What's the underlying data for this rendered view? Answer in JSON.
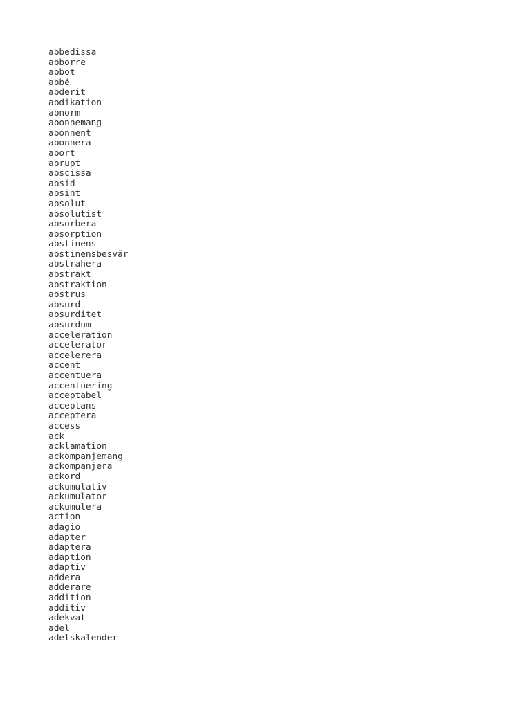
{
  "page": {
    "kind": "plain-text-word-list",
    "background_color": "#ffffff",
    "text_color": "#333333"
  },
  "word_list": {
    "items": [
      "abbedissa",
      "abborre",
      "abbot",
      "abbé",
      "abderit",
      "abdikation",
      "abnorm",
      "abonnemang",
      "abonnent",
      "abonnera",
      "abort",
      "abrupt",
      "abscissa",
      "absid",
      "absint",
      "absolut",
      "absolutist",
      "absorbera",
      "absorption",
      "abstinens",
      "abstinensbesvär",
      "abstrahera",
      "abstrakt",
      "abstraktion",
      "abstrus",
      "absurd",
      "absurditet",
      "absurdum",
      "acceleration",
      "accelerator",
      "accelerera",
      "accent",
      "accentuera",
      "accentuering",
      "acceptabel",
      "acceptans",
      "acceptera",
      "access",
      "ack",
      "acklamation",
      "ackompanjemang",
      "ackompanjera",
      "ackord",
      "ackumulativ",
      "ackumulator",
      "ackumulera",
      "action",
      "adagio",
      "adapter",
      "adaptera",
      "adaption",
      "adaptiv",
      "addera",
      "adderare",
      "addition",
      "additiv",
      "adekvat",
      "adel",
      "adelskalender"
    ]
  }
}
